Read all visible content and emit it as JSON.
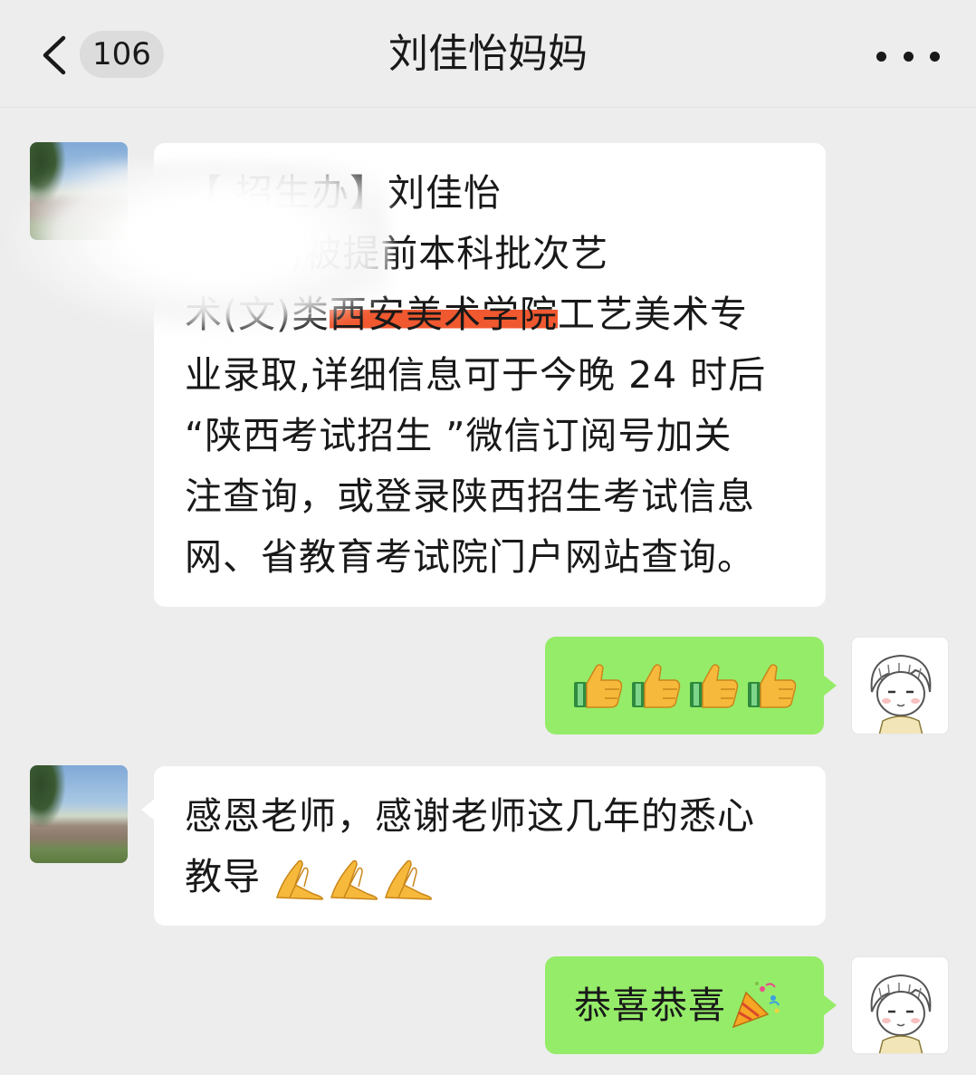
{
  "header": {
    "back_count": "106",
    "title": "刘佳怡妈妈"
  },
  "messages": {
    "m1": {
      "sender": "peer",
      "lines": [
        "【   招生办】刘佳怡",
        "(  65)被提前本科批次艺",
        "术(文)类",
        "工艺美术专",
        "业录取,详细信息可于今晚 24 时后",
        "“陕西考试招生 ”微信订阅号加关",
        "注查询，或登录陕西招生考试信息",
        "网、省教育考试院门户网站查询。"
      ],
      "highlighted": "西安美术学院"
    },
    "m2": {
      "sender": "self",
      "emoji": "thumbs-up ×4"
    },
    "m3": {
      "sender": "peer",
      "lines": [
        "感恩老师，感谢老师这几年的悉心",
        "教导"
      ],
      "emoji": "folded-hands ×3"
    },
    "m4": {
      "sender": "self",
      "text": "恭喜恭喜",
      "emoji": "party-popper"
    }
  },
  "colors": {
    "background": "#ededed",
    "bubble_in": "#ffffff",
    "bubble_out": "#95ec69",
    "highlight": "#f0582f"
  }
}
